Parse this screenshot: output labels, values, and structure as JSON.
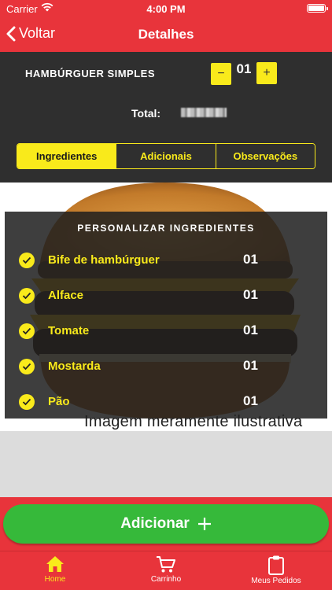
{
  "status_bar": {
    "carrier": "Carrier",
    "time": "4:00 PM"
  },
  "nav": {
    "back_label": "Voltar",
    "title": "Detalhes"
  },
  "product": {
    "name": "HAMBÚRGUER SIMPLES",
    "quantity": "01",
    "minus_label": "−",
    "plus_label": "+",
    "total_label": "Total:"
  },
  "tabs": [
    {
      "label": "Ingredientes",
      "active": true
    },
    {
      "label": "Adicionais",
      "active": false
    },
    {
      "label": "Observações",
      "active": false
    }
  ],
  "image": {
    "caption": "Imagem meramente ilustrativa"
  },
  "ingredients_panel": {
    "title": "PERSONALIZAR INGREDIENTES",
    "items": [
      {
        "name": "Bife de hambúrguer",
        "qty": "01",
        "checked": true
      },
      {
        "name": "Alface",
        "qty": "01",
        "checked": true
      },
      {
        "name": "Tomate",
        "qty": "01",
        "checked": true
      },
      {
        "name": "Mostarda",
        "qty": "01",
        "checked": true
      },
      {
        "name": "Pão",
        "qty": "01",
        "checked": true
      }
    ]
  },
  "add_button": {
    "label": "Adicionar",
    "icon": "plus-icon"
  },
  "tab_bar": [
    {
      "label": "Home",
      "icon": "home-icon",
      "active": true
    },
    {
      "label": "Carrinho",
      "icon": "cart-icon",
      "active": false
    },
    {
      "label": "Meus Pedidos",
      "icon": "clipboard-icon",
      "active": false
    }
  ],
  "colors": {
    "primary_red": "#e8343b",
    "accent_yellow": "#f9ea1b",
    "panel_dark": "#2f2f2f",
    "button_green": "#36b93a"
  }
}
